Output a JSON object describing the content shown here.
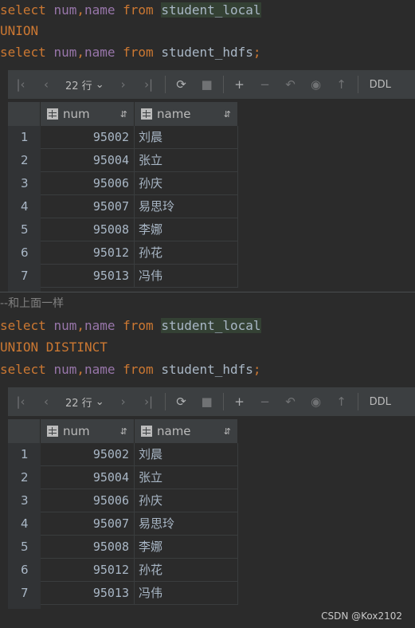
{
  "editor": {
    "block1": {
      "line1": {
        "kw": "select",
        "col1": "num",
        "comma": ",",
        "col2": "name",
        "from": "from",
        "table": "student_local"
      },
      "line2": {
        "kw": "UNION"
      },
      "line3": {
        "kw": "select",
        "col1": "num",
        "comma": ",",
        "col2": "name",
        "from": "from",
        "table": "student_hdfs",
        "semicolon": ";"
      }
    },
    "comment": "--和上面一样",
    "block2": {
      "line1": {
        "kw": "select",
        "col1": "num",
        "comma": ",",
        "col2": "name",
        "from": "from",
        "table": "student_local"
      },
      "line2": {
        "kw": "UNION DISTINCT"
      },
      "line3": {
        "kw": "select",
        "col1": "num",
        "comma": ",",
        "col2": "name",
        "from": "from",
        "table": "student_hdfs",
        "semicolon": ";"
      }
    }
  },
  "toolbar": {
    "first_icon": "first-page-icon",
    "prev_icon": "previous-page-icon",
    "rows_label": "22 行",
    "rows_chevron": "chevron-down-icon",
    "next_icon": "next-page-icon",
    "last_icon": "last-page-icon",
    "reload_icon": "reload-icon",
    "stop_icon": "stop-icon",
    "add_icon": "add-row-icon",
    "remove_icon": "remove-row-icon",
    "revert_icon": "revert-icon",
    "preview_icon": "preview-icon",
    "submit_icon": "submit-icon",
    "ddl_label": "DDL"
  },
  "results": {
    "columns": [
      {
        "label": "num"
      },
      {
        "label": "name"
      }
    ],
    "rows": [
      {
        "idx": "1",
        "num": "95002",
        "name": "刘晨"
      },
      {
        "idx": "2",
        "num": "95004",
        "name": "张立"
      },
      {
        "idx": "3",
        "num": "95006",
        "name": "孙庆"
      },
      {
        "idx": "4",
        "num": "95007",
        "name": "易思玲"
      },
      {
        "idx": "5",
        "num": "95008",
        "name": "李娜"
      },
      {
        "idx": "6",
        "num": "95012",
        "name": "孙花"
      },
      {
        "idx": "7",
        "num": "95013",
        "name": "冯伟"
      }
    ]
  },
  "watermark": "CSDN @Kox2102",
  "colors": {
    "keyword": "#cc7832",
    "column": "#9876aa",
    "text": "#a9b7c6",
    "background": "#2b2b2b",
    "toolbar": "#3c3f41"
  }
}
